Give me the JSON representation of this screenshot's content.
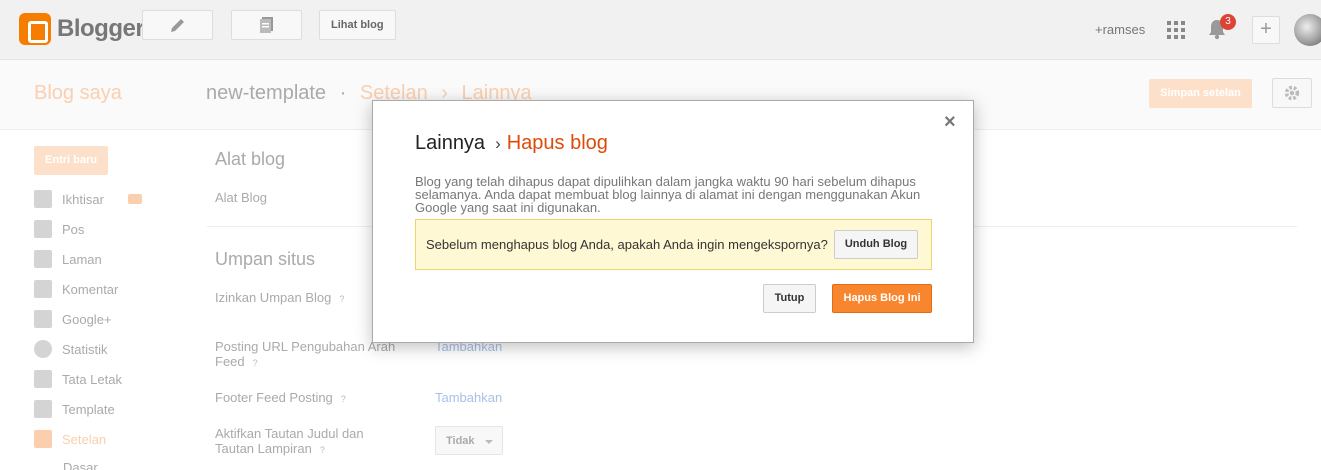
{
  "topbar": {
    "logo_text": "Blogger",
    "view_blog_label": "Lihat blog",
    "user_name": "+ramses",
    "notification_count": "3",
    "plus_label": "+"
  },
  "header": {
    "blog_saya": "Blog saya",
    "blog_name": "new-template",
    "dot": "·",
    "settings_crumb": "Setelan",
    "arrow": "›",
    "other_crumb": "Lainnya",
    "save_label": "Simpan setelan"
  },
  "sidebar": {
    "new_post_label": "Entri baru",
    "items": [
      {
        "label": "Ikhtisar",
        "icon": "home-icon"
      },
      {
        "label": "Pos",
        "icon": "posts-icon"
      },
      {
        "label": "Laman",
        "icon": "pages-icon"
      },
      {
        "label": "Komentar",
        "icon": "comment-icon"
      },
      {
        "label": "Google+",
        "icon": "google-plus-icon"
      },
      {
        "label": "Statistik",
        "icon": "pie-chart-icon"
      },
      {
        "label": "Tata Letak",
        "icon": "layout-icon"
      },
      {
        "label": "Template",
        "icon": "paint-roller-icon"
      },
      {
        "label": "Setelan",
        "icon": "wrench-icon"
      }
    ],
    "sub_item": "Dasar"
  },
  "settings": {
    "blog_tools_title": "Alat blog",
    "blog_tools_label": "Alat Blog",
    "feed_title": "Umpan situs",
    "allow_feed_label": "Izinkan Umpan Blog",
    "post_feed_redirect_label": "Posting URL Pengubahan Arah Feed",
    "post_feed_redirect_link": "Tambahkan",
    "footer_feed_label": "Footer Feed Posting",
    "footer_feed_link": "Tambahkan",
    "enclosure_label": "Aktifkan Tautan Judul dan Tautan Lampiran",
    "enclosure_value": "Tidak",
    "help_mark": "?"
  },
  "dialog": {
    "close_symbol": "×",
    "title_parent": "Lainnya",
    "title_sep": "›",
    "title_current": "Hapus blog",
    "description": "Blog yang telah dihapus dapat dipulihkan dalam jangka waktu 90 hari sebelum dihapus selamanya. Anda dapat membuat blog lainnya di alamat ini dengan menggunakan Akun Google yang saat ini digunakan.",
    "warning_text": "Sebelum menghapus blog Anda, apakah Anda ingin mengekspornya?",
    "download_label": "Unduh Blog",
    "close_label": "Tutup",
    "delete_label": "Hapus Blog Ini"
  },
  "colors": {
    "accent": "#f8862e",
    "title_orange": "#dd4b09",
    "warning_bg": "#fff8d4"
  }
}
